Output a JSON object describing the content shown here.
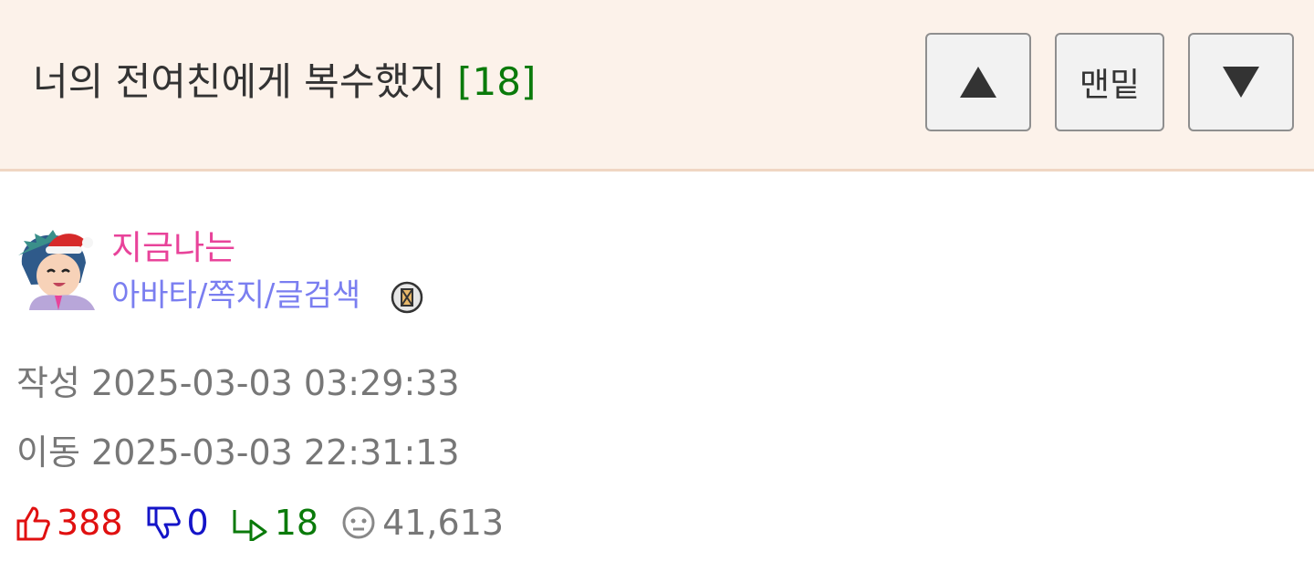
{
  "header": {
    "title": "너의 전여친에게 복수했지",
    "comment_count": "[18]",
    "bottom_label": "맨밑",
    "up_icon": "triangle-up-icon",
    "down_icon": "triangle-down-icon"
  },
  "author": {
    "nickname": "지금나는",
    "links": "아바타/쪽지/글검색",
    "avatar_icon": "santa-hat-avatar",
    "badge_icon": "level-badge-icon"
  },
  "meta": {
    "written_label": "작성",
    "written_time": "2025-03-03 03:29:33",
    "moved_label": "이동",
    "moved_time": "2025-03-03 22:31:13"
  },
  "stats": {
    "likes": "388",
    "dislikes": "0",
    "replies": "18",
    "views": "41,613"
  },
  "colors": {
    "header_bg": "#fcf2ea",
    "nickname": "#e8439a",
    "links": "#7a7ef0",
    "likes": "#e01010",
    "dislikes": "#1414c8",
    "replies": "#0a7a0a",
    "views": "#777777"
  }
}
